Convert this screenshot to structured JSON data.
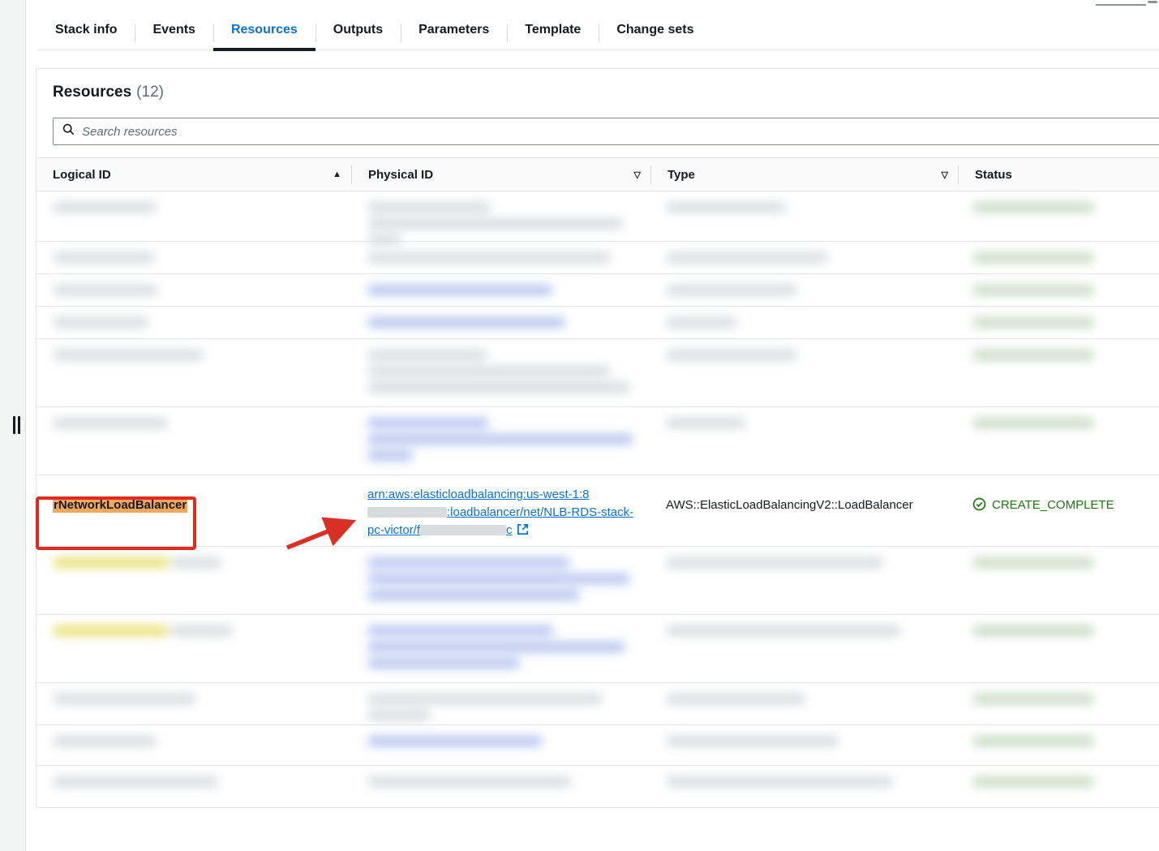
{
  "window": {
    "scrollbar": "vertical-scrollbar"
  },
  "tabs": [
    {
      "label": "Stack info",
      "active": false
    },
    {
      "label": "Events",
      "active": false
    },
    {
      "label": "Resources",
      "active": true
    },
    {
      "label": "Outputs",
      "active": false
    },
    {
      "label": "Parameters",
      "active": false
    },
    {
      "label": "Template",
      "active": false
    },
    {
      "label": "Change sets",
      "active": false
    }
  ],
  "panel": {
    "title": "Resources",
    "count": "(12)"
  },
  "search": {
    "placeholder": "Search resources",
    "value": "",
    "icon": "search-icon"
  },
  "table": {
    "columns": [
      {
        "label": "Logical ID",
        "sort_icon": "sort-ascending-icon",
        "sort_glyph": "▲"
      },
      {
        "label": "Physical ID",
        "sort_icon": "sort-descending-icon",
        "sort_glyph": "▽"
      },
      {
        "label": "Type",
        "sort_icon": "sort-descending-icon",
        "sort_glyph": "▽"
      },
      {
        "label": "Status",
        "sort_icon": "",
        "sort_glyph": ""
      }
    ],
    "highlighted_row": {
      "logical_id": "rNetworkLoadBalancer",
      "physical_id_text": "arn:aws:elasticloadbalancing:us-west-1:8",
      "physical_id_text2": ":loadbalancer/net/NLB-RDS-stack-pc-victor/f",
      "physical_id_text3": "c",
      "external_link_icon": "external-link-icon",
      "type": "AWS::ElasticLoadBalancingV2::LoadBalancer",
      "status": "CREATE_COMPLETE",
      "status_icon": "status-success-icon"
    }
  },
  "annotations": {
    "highlight_box": "red-rectangle-annotation",
    "pointer": "red-arrow-annotation",
    "logical_id_highlight_color": "#f0a85c",
    "box_color": "#e02b1d",
    "status_color": "#1d7510",
    "link_color": "#0972d3"
  }
}
